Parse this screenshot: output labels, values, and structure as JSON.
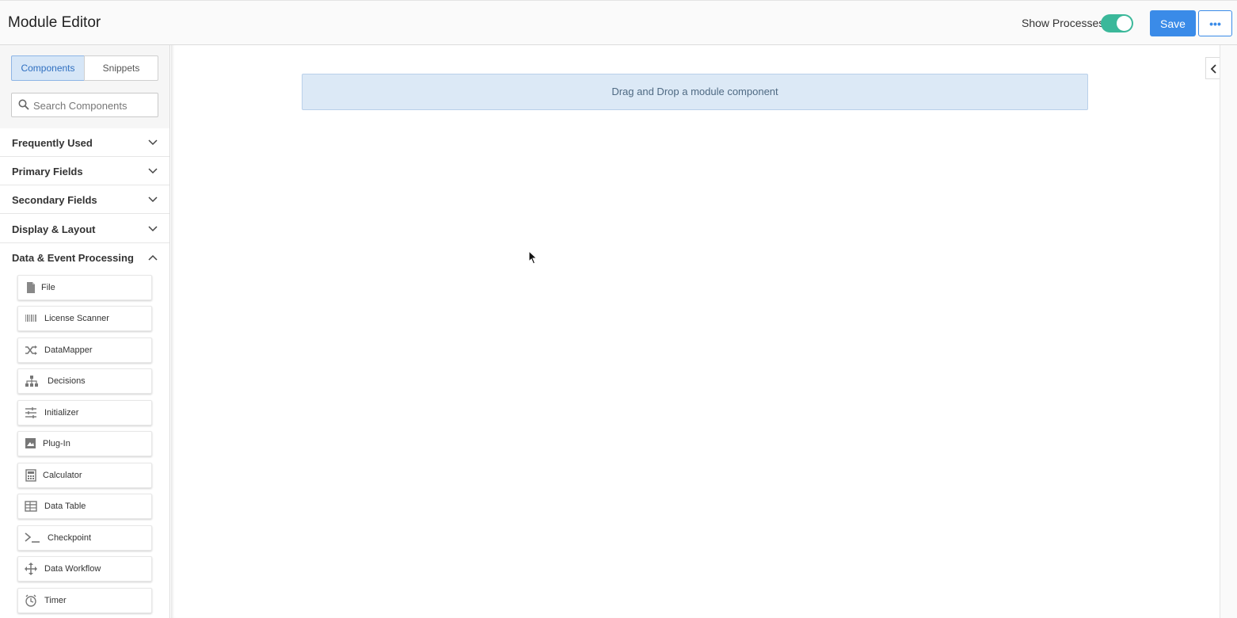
{
  "header": {
    "title": "Module Editor",
    "show_processes_label": "Show Processes",
    "show_processes_on": true,
    "save_label": "Save",
    "more_label": "•••"
  },
  "sidebar": {
    "tabs": [
      {
        "label": "Components",
        "active": true
      },
      {
        "label": "Snippets",
        "active": false
      }
    ],
    "search_placeholder": "Search Components",
    "categories": [
      {
        "label": "Frequently Used",
        "expanded": false
      },
      {
        "label": "Primary Fields",
        "expanded": false
      },
      {
        "label": "Secondary Fields",
        "expanded": false
      },
      {
        "label": "Display & Layout",
        "expanded": false
      },
      {
        "label": "Data & Event Processing",
        "expanded": true
      }
    ],
    "items": [
      {
        "label": "File",
        "icon": "file-icon"
      },
      {
        "label": "License Scanner",
        "icon": "barcode-icon"
      },
      {
        "label": "DataMapper",
        "icon": "shuffle-icon"
      },
      {
        "label": "Decisions",
        "icon": "sitemap-icon"
      },
      {
        "label": "Initializer",
        "icon": "sliders-icon"
      },
      {
        "label": "Plug-In",
        "icon": "plugin-icon"
      },
      {
        "label": "Calculator",
        "icon": "calculator-icon"
      },
      {
        "label": "Data Table",
        "icon": "table-icon"
      },
      {
        "label": "Checkpoint",
        "icon": "terminal-icon"
      },
      {
        "label": "Data Workflow",
        "icon": "move-icon"
      },
      {
        "label": "Timer",
        "icon": "timer-icon"
      }
    ]
  },
  "canvas": {
    "dropzone_text": "Drag and Drop a module component"
  },
  "colors": {
    "accent": "#3a8be8",
    "toggle": "#3bb89a",
    "dropzone": "#dce9f6"
  }
}
